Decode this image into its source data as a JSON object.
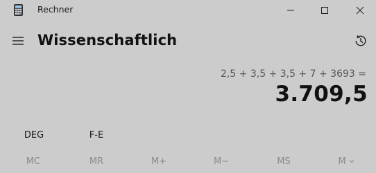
{
  "window": {
    "title": "Rechner",
    "app_icon": "calculator-icon",
    "controls": [
      "minimize-icon",
      "maximize-icon",
      "close-icon"
    ]
  },
  "header": {
    "menu_icon": "hamburger-menu-icon",
    "mode_title": "Wissenschaftlich",
    "history_icon": "history-icon"
  },
  "display": {
    "expression": "2,5 + 3,5 + 3,5 + 7 + 3693 =",
    "result": "3.709,5"
  },
  "modes": {
    "angle_unit": "DEG",
    "notation": "F-E"
  },
  "memory": {
    "mc": "MC",
    "mr": "MR",
    "m_plus": "M+",
    "m_minus": "M−",
    "ms": "MS",
    "m_list": "M",
    "m_list_icon": "chevron-down-icon"
  },
  "colors": {
    "background": "#cccccc",
    "text": "#1a1a1a",
    "muted_text": "#8a8a8a"
  }
}
